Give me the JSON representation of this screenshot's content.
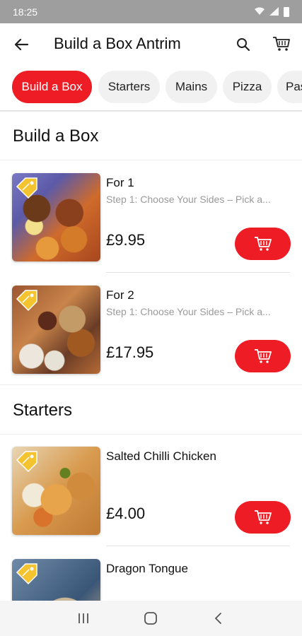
{
  "status_bar": {
    "time": "18:25"
  },
  "app_bar": {
    "title": "Build a Box Antrim"
  },
  "tabs": [
    {
      "label": "Build a Box",
      "active": true
    },
    {
      "label": "Starters",
      "active": false
    },
    {
      "label": "Mains",
      "active": false
    },
    {
      "label": "Pizza",
      "active": false
    },
    {
      "label": "Pas",
      "active": false
    }
  ],
  "sections": [
    {
      "title": "Build a Box",
      "items": [
        {
          "name": "For 1",
          "description": "Step 1: Choose Your Sides – Pick a...",
          "price": "£9.95"
        },
        {
          "name": "For 2",
          "description": "Step 1: Choose Your Sides – Pick a...",
          "price": "£17.95"
        }
      ]
    },
    {
      "title": "Starters",
      "items": [
        {
          "name": "Salted Chilli Chicken",
          "description": "",
          "price": "£4.00"
        },
        {
          "name": "Dragon Tongue",
          "description": "",
          "price": ""
        }
      ]
    }
  ],
  "colors": {
    "accent": "#ee1c25",
    "tab_inactive_bg": "#f1f1f1",
    "desc_text": "#9a9a9a",
    "tag": "#f4c430"
  },
  "icons": {
    "back": "arrow-left-icon",
    "search": "search-icon",
    "cart": "cart-icon",
    "add": "cart-add-icon",
    "discount": "price-tag-icon",
    "nav_recents": "recents-icon",
    "nav_home": "home-icon",
    "nav_back": "nav-back-icon"
  }
}
